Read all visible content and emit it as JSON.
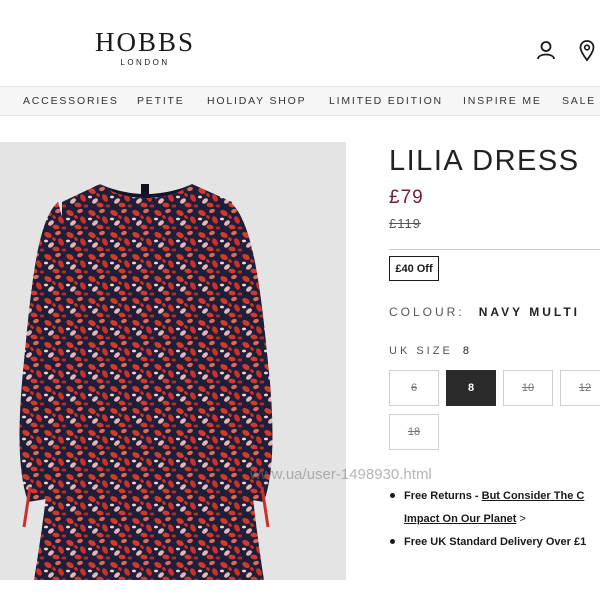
{
  "header": {
    "logo_main": "HOBBS",
    "logo_sub": "LONDON",
    "icons": [
      "account-icon",
      "store-locator-icon"
    ]
  },
  "nav": {
    "items": [
      "ACCESSORIES",
      "PETITE",
      "HOLIDAY SHOP",
      "LIMITED EDITION",
      "INSPIRE ME",
      "SALE"
    ]
  },
  "product": {
    "title": "LILIA DRESS",
    "price": "£79",
    "was_price": "£119",
    "discount": "£40 Off",
    "colour_label": "COLOUR:",
    "colour_value": "NAVY MULTI",
    "size_label": "UK SIZE",
    "size_value": "8",
    "sizes": [
      {
        "label": "6",
        "available": false,
        "selected": false
      },
      {
        "label": "8",
        "available": true,
        "selected": true
      },
      {
        "label": "10",
        "available": false,
        "selected": false
      },
      {
        "label": "12",
        "available": false,
        "selected": false
      },
      {
        "label": "18",
        "available": false,
        "selected": false
      }
    ],
    "image_alt": "Lilia dress in navy multi print"
  },
  "info": {
    "returns_prefix": "Free Returns - ",
    "returns_link_1": "But Consider The C",
    "returns_link_2": "Impact On Our Planet",
    "returns_suffix": " >",
    "delivery": "Free UK Standard Delivery Over £1"
  },
  "watermark": "www.ua/user-1498930.html",
  "colors": {
    "price": "#7a1a3a",
    "selected_size": "#2a2a2a",
    "dress_base": "#c63a2c",
    "dress_navy": "#1e1f3a"
  }
}
